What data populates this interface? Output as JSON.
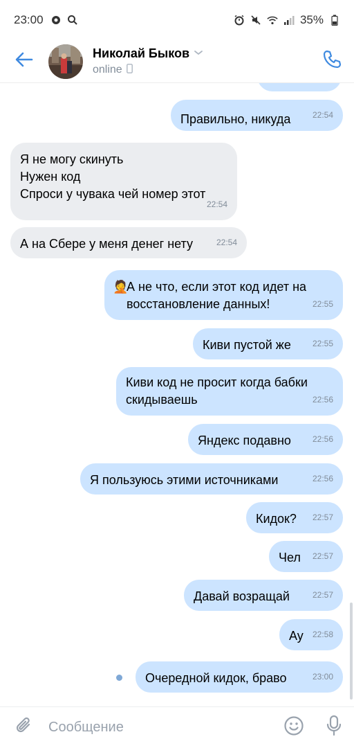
{
  "status_bar": {
    "time": "23:00",
    "battery": "35%"
  },
  "header": {
    "contact_name": "Николай Быков",
    "status": "online"
  },
  "messages": [
    {
      "direction": "out",
      "text": "Правильно, никуда",
      "time": "22:54"
    },
    {
      "direction": "in",
      "text": "Я не могу скинуть\nНужен код\nСпроси у чувака чей номер этот",
      "time": "22:54"
    },
    {
      "direction": "in",
      "text": "А на Сбере у меня денег нету",
      "time": "22:54"
    },
    {
      "direction": "out",
      "text": "А не что, если этот код идет на\nвосстановление данных!",
      "emoji": "🤦",
      "time": "22:55"
    },
    {
      "direction": "out",
      "text": "Киви пустой же",
      "time": "22:55"
    },
    {
      "direction": "out",
      "text": "Киви код не просит когда бабки\nскидываешь",
      "time": "22:56"
    },
    {
      "direction": "out",
      "text": "Яндекс подавно",
      "time": "22:56"
    },
    {
      "direction": "out",
      "text": "Я пользуюсь этими источниками",
      "time": "22:56"
    },
    {
      "direction": "out",
      "text": "Кидок?",
      "time": "22:57"
    },
    {
      "direction": "out",
      "text": "Чел",
      "time": "22:57"
    },
    {
      "direction": "out",
      "text": "Давай возращай",
      "time": "22:57"
    },
    {
      "direction": "out",
      "text": "Ау",
      "time": "22:58"
    },
    {
      "direction": "out",
      "text": "Очередной кидок, браво",
      "time": "23:00",
      "unread": true
    }
  ],
  "composer": {
    "placeholder": "Сообщение"
  },
  "icons": {
    "back": "arrow-left-icon",
    "call": "phone-icon",
    "attach": "paperclip-icon",
    "emoji": "smile-icon",
    "mic": "microphone-icon"
  },
  "colors": {
    "accent": "#3f8ae0",
    "outgoing_bubble": "#cce4ff",
    "incoming_bubble": "#ebedf0",
    "secondary_text": "#818c99"
  }
}
